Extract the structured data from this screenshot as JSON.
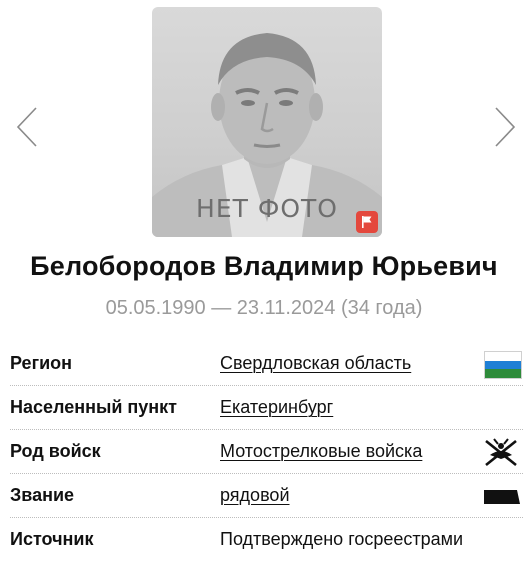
{
  "photo": {
    "placeholder_label": "НЕТ ФОТО",
    "icons": [
      "chevron-left-icon",
      "chevron-right-icon",
      "flag-icon"
    ]
  },
  "person": {
    "full_name": "Белобородов Владимир Юрьевич",
    "dates": "05.05.1990 — 23.11.2024 (34 года)"
  },
  "details": [
    {
      "label": "Регион",
      "value": "Свердловская область",
      "icon": "region-flag-icon"
    },
    {
      "label": "Населенный пункт",
      "value": "Екатеринбург"
    },
    {
      "label": "Род войск",
      "value": "Мотострелковые войска",
      "icon": "motor-rifle-emblem-icon"
    },
    {
      "label": "Звание",
      "value": "рядовой",
      "icon": "rank-insignia-icon"
    },
    {
      "label": "Источник",
      "value": "Подтверждено госреестрами"
    }
  ],
  "colors": {
    "flag_button": "#e4483d",
    "region_flag": [
      "#ffffff",
      "#1f7fd6",
      "#2e8b3a"
    ],
    "muted_text": "#9a9a9a"
  }
}
